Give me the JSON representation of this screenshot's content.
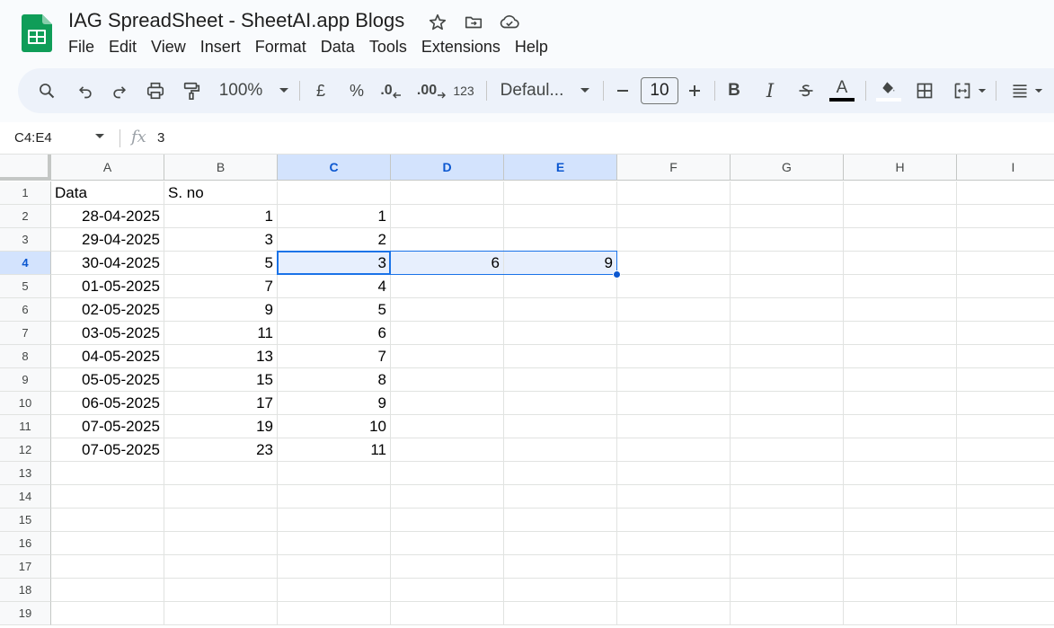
{
  "title": {
    "doc_title": "IAG SpreadSheet - SheetAI.app Blogs",
    "icons": [
      "star-icon",
      "move-to-folder-icon",
      "cloud-saved-icon"
    ]
  },
  "menu": [
    "File",
    "Edit",
    "View",
    "Insert",
    "Format",
    "Data",
    "Tools",
    "Extensions",
    "Help"
  ],
  "toolbar": {
    "zoom": "100%",
    "currency": "£",
    "percent": "%",
    "decrease_decimal": ".0",
    "increase_decimal": ".00",
    "number_format": "123",
    "font": "Defaul...",
    "font_size": "10",
    "bold": "B",
    "italic": "I",
    "text_color_letter": "A",
    "text_color": "#000000",
    "fill_color": "#ffffff"
  },
  "formula_bar": {
    "name_box": "C4:E4",
    "fx": "fx",
    "value": "3"
  },
  "columns": [
    "A",
    "B",
    "C",
    "D",
    "E",
    "F",
    "G",
    "H",
    "I"
  ],
  "selected_columns": [
    "C",
    "D",
    "E"
  ],
  "selected_row": "4",
  "rows": [
    {
      "n": "1",
      "cells": [
        "Data",
        "S. no",
        "",
        "",
        ""
      ]
    },
    {
      "n": "2",
      "cells": [
        "28-04-2025",
        "1",
        "1",
        "",
        ""
      ]
    },
    {
      "n": "3",
      "cells": [
        "29-04-2025",
        "3",
        "2",
        "",
        ""
      ]
    },
    {
      "n": "4",
      "cells": [
        "30-04-2025",
        "5",
        "3",
        "6",
        "9"
      ]
    },
    {
      "n": "5",
      "cells": [
        "01-05-2025",
        "7",
        "4",
        "",
        ""
      ]
    },
    {
      "n": "6",
      "cells": [
        "02-05-2025",
        "9",
        "5",
        "",
        ""
      ]
    },
    {
      "n": "7",
      "cells": [
        "03-05-2025",
        "11",
        "6",
        "",
        ""
      ]
    },
    {
      "n": "8",
      "cells": [
        "04-05-2025",
        "13",
        "7",
        "",
        ""
      ]
    },
    {
      "n": "9",
      "cells": [
        "05-05-2025",
        "15",
        "8",
        "",
        ""
      ]
    },
    {
      "n": "10",
      "cells": [
        "06-05-2025",
        "17",
        "9",
        "",
        ""
      ]
    },
    {
      "n": "11",
      "cells": [
        "07-05-2025",
        "19",
        "10",
        "",
        ""
      ]
    },
    {
      "n": "12",
      "cells": [
        "07-05-2025",
        "23",
        "11",
        "",
        ""
      ]
    },
    {
      "n": "13",
      "cells": [
        "",
        "",
        "",
        "",
        ""
      ]
    },
    {
      "n": "14",
      "cells": [
        "",
        "",
        "",
        "",
        ""
      ]
    },
    {
      "n": "15",
      "cells": [
        "",
        "",
        "",
        "",
        ""
      ]
    },
    {
      "n": "16",
      "cells": [
        "",
        "",
        "",
        "",
        ""
      ]
    },
    {
      "n": "17",
      "cells": [
        "",
        "",
        "",
        "",
        ""
      ]
    },
    {
      "n": "18",
      "cells": [
        "",
        "",
        "",
        "",
        ""
      ]
    },
    {
      "n": "19",
      "cells": [
        "",
        "",
        "",
        "",
        ""
      ]
    }
  ],
  "colors": {
    "accent": "#1a73e8",
    "selection_fill": "#e7effd",
    "header_selected": "#d3e3fd",
    "sheets_green": "#0f9d58"
  }
}
